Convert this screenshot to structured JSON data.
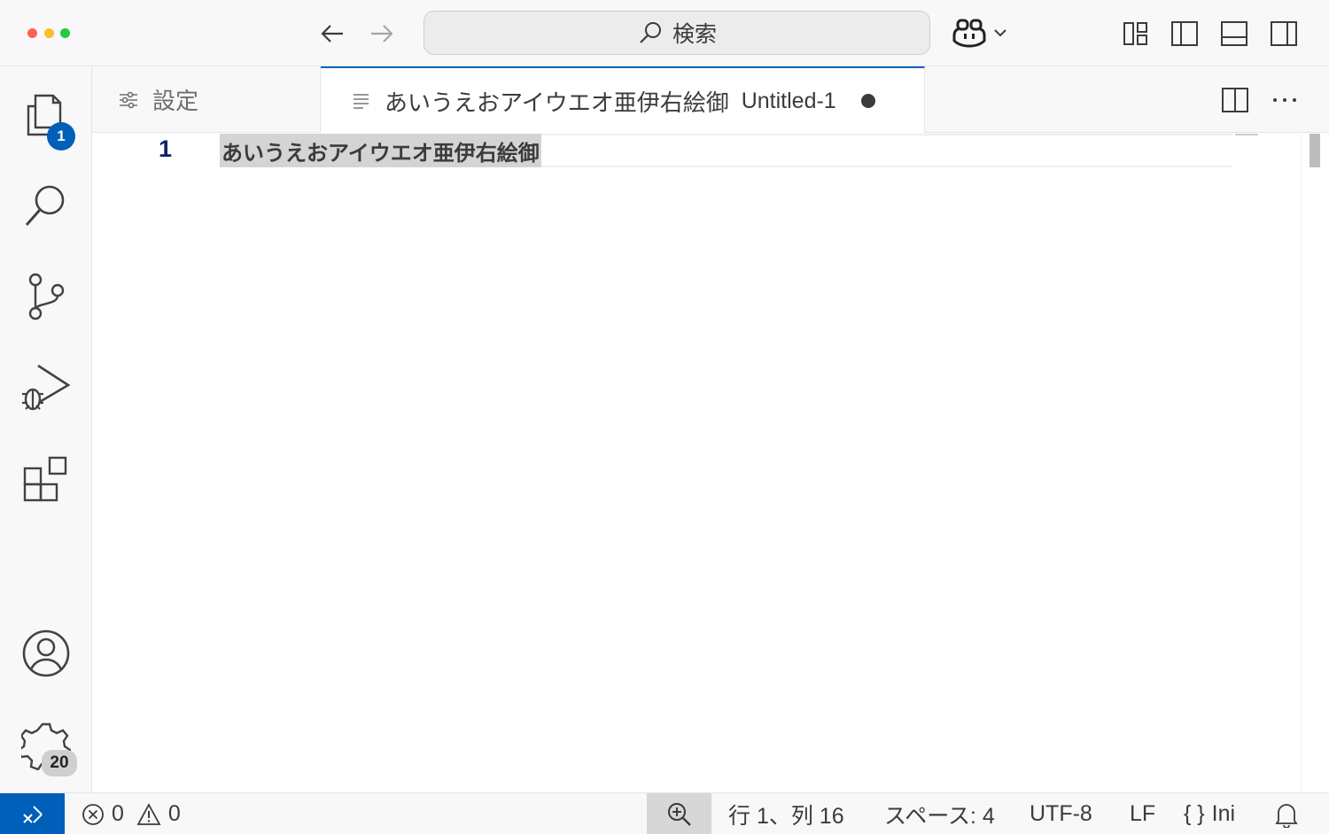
{
  "titlebar": {
    "search_label": "検索"
  },
  "activity": {
    "explorer_badge": "1",
    "manage_badge": "20"
  },
  "tabs": {
    "settings_label": "設定",
    "active_title": "あいうえおアイウエオ亜伊右絵御",
    "active_file": "Untitled-1"
  },
  "editor": {
    "line_number": "1",
    "line_text": "あいうえおアイウエオ亜伊右絵御"
  },
  "status": {
    "errors": "0",
    "warnings": "0",
    "position": "行 1、列 16",
    "indent": "スペース: 4",
    "encoding": "UTF-8",
    "eol": "LF",
    "language": "Ini"
  },
  "colors": {
    "accent": "#005fb8",
    "line_number": "#0b216f",
    "selection": "#d4d4d4"
  },
  "icons": [
    "back-arrow-icon",
    "forward-arrow-icon",
    "search-icon",
    "copilot-icon",
    "chevron-down-icon",
    "customize-layout-icon",
    "toggle-primary-sidebar-icon",
    "toggle-panel-icon",
    "toggle-secondary-sidebar-icon",
    "files-icon",
    "search-icon",
    "source-control-icon",
    "run-debug-icon",
    "extensions-icon",
    "account-icon",
    "gear-icon",
    "settings-sliders-icon",
    "text-file-icon",
    "split-editor-icon",
    "more-actions-icon",
    "remote-icon",
    "error-icon",
    "warning-icon",
    "zoom-icon",
    "bell-icon"
  ]
}
